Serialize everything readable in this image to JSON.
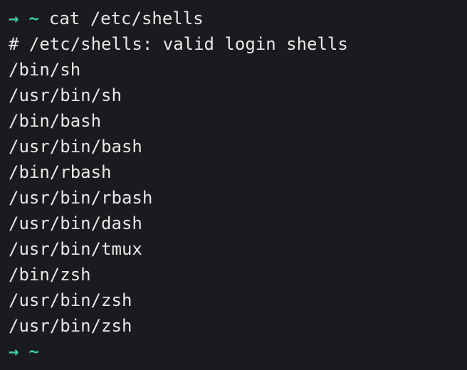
{
  "prompt1": {
    "arrow": "→",
    "tilde": "~",
    "command": "cat /etc/shells"
  },
  "output": {
    "comment": "# /etc/shells: valid login shells",
    "lines": [
      "/bin/sh",
      "/usr/bin/sh",
      "/bin/bash",
      "/usr/bin/bash",
      "/bin/rbash",
      "/usr/bin/rbash",
      "/usr/bin/dash",
      "/usr/bin/tmux",
      "/bin/zsh",
      "/usr/bin/zsh",
      "/usr/bin/zsh"
    ]
  },
  "prompt2": {
    "arrow": "→",
    "tilde": "~"
  }
}
